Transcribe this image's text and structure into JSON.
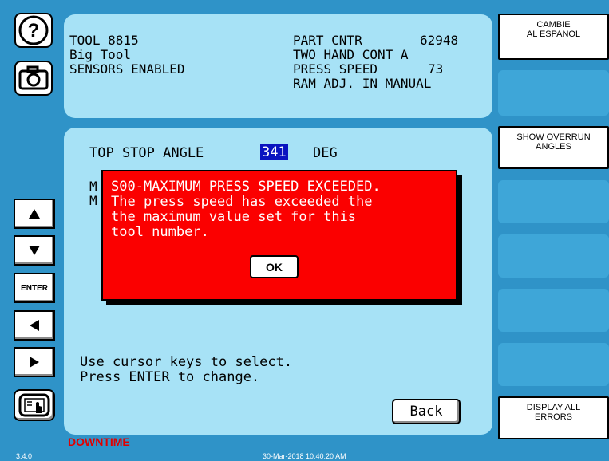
{
  "header": {
    "tool_label": "TOOL 8815",
    "tool_name": "Big Tool",
    "sensors": "SENSORS ENABLED",
    "part_cntr_label": "PART CNTR",
    "part_cntr_value": "62948",
    "two_hand": "TWO HAND CONT A",
    "press_speed_label": "PRESS SPEED",
    "press_speed_value": "73",
    "ram_adj": "RAM ADJ. IN MANUAL"
  },
  "main": {
    "top_stop_label": "TOP STOP ANGLE",
    "top_stop_value": "341",
    "top_stop_unit": "DEG",
    "hidden_line_1": "M",
    "hidden_line_2": "M",
    "instructions_1": "Use cursor keys to select.",
    "instructions_2": "Press ENTER to change.",
    "back_label": "Back"
  },
  "dialog": {
    "line1": "S00-MAXIMUM PRESS SPEED EXCEEDED.",
    "line2": "The press speed has exceeded the",
    "line3": "the maximum value set for this",
    "line4": "tool number.",
    "ok_label": "OK"
  },
  "left_buttons": {
    "help_icon": "question-mark-icon",
    "camera_icon": "camera-icon",
    "up_icon": "arrow-up-icon",
    "down_icon": "arrow-down-icon",
    "enter_label": "ENTER",
    "left_icon": "arrow-left-icon",
    "right_icon": "arrow-right-icon",
    "touch_icon": "touch-screen-icon"
  },
  "softkeys": {
    "spanish_line1": "CAMBIE",
    "spanish_line2": "AL ESPANOL",
    "overrun_line1": "SHOW OVERRUN",
    "overrun_line2": "ANGLES",
    "errors_line1": "DISPLAY ALL",
    "errors_line2": "ERRORS"
  },
  "footer": {
    "version": "3.4.0",
    "status": "DOWNTIME",
    "datetime": "30-Mar-2018 10:40:20 AM"
  },
  "colors": {
    "background": "#2f93c8",
    "panel": "#a7e2f6",
    "dialog": "#fb0000",
    "highlight": "#0a14c0",
    "status_text": "#e00000"
  }
}
